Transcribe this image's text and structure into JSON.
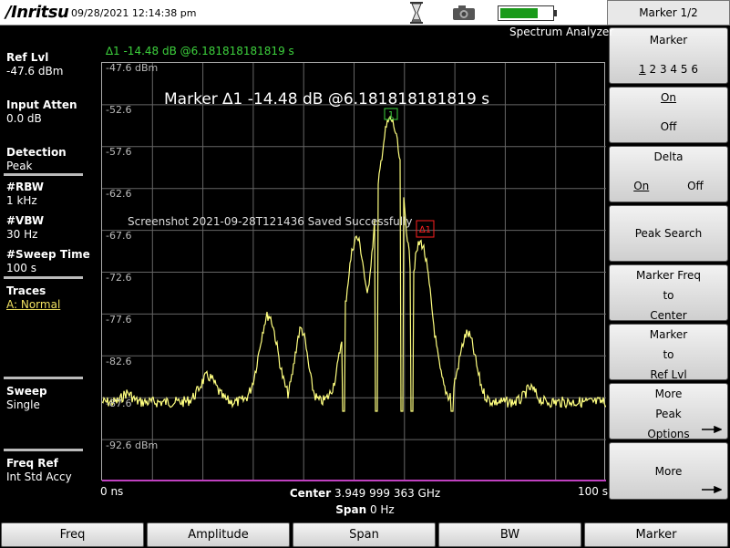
{
  "header": {
    "brand": "/Inritsu",
    "datetime": "09/28/2021 12:14:38 pm",
    "mode": "Spectrum Analyzer"
  },
  "softkeys": {
    "title": "Marker 1/2",
    "marker": {
      "label": "Marker",
      "numbers": [
        "1",
        "2",
        "3",
        "4",
        "5",
        "6"
      ],
      "selected": "1"
    },
    "on_off": {
      "on": "On",
      "off": "Off"
    },
    "delta": {
      "label": "Delta",
      "on": "On",
      "off": "Off"
    },
    "peak_search": "Peak Search",
    "marker_freq_to_center": [
      "Marker Freq",
      "to",
      "Center"
    ],
    "marker_to_ref_lvl": [
      "Marker",
      "to",
      "Ref Lvl"
    ],
    "more_peak_options": [
      "More",
      "Peak",
      "Options"
    ],
    "more": "More"
  },
  "left": {
    "ref_lvl_label": "Ref Lvl",
    "ref_lvl_value": "-47.6 dBm",
    "input_atten_label": "Input Atten",
    "input_atten_value": "0.0 dB",
    "detection_label": "Detection",
    "detection_value": "Peak",
    "rbw_label": "#RBW",
    "rbw_value": "1 kHz",
    "vbw_label": "#VBW",
    "vbw_value": "30 Hz",
    "sweep_time_label": "#Sweep Time",
    "sweep_time_value": "100 s",
    "traces_label": "Traces",
    "traces_value": "A: Normal",
    "sweep_label": "Sweep",
    "sweep_value": "Single",
    "freq_ref_label": "Freq Ref",
    "freq_ref_value": "Int Std Accy"
  },
  "plot": {
    "marker_readout": "∆1 -14.48 dB @6.181818181819 s",
    "big_marker": "Marker ∆1 -14.48 dB @6.181818181819 s",
    "save_message": "Screenshot 2021-09-28T121436 Saved Successfully",
    "marker1_tag": "1",
    "delta_tag": "∆1",
    "y_labels": [
      "-47.6 dBm",
      "-52.6",
      "-57.6",
      "-62.6",
      "-67.6",
      "-72.6",
      "-77.6",
      "-82.6",
      "-87.6",
      "-92.6 dBm"
    ],
    "x_start": "0 ns",
    "x_end": "100 s",
    "center_label": "Center",
    "center_value": "3.949 999 363 GHz",
    "span_label": "Span",
    "span_value": "0 Hz",
    "trace_color": "#ffff80"
  },
  "tabs": [
    "Freq",
    "Amplitude",
    "Span",
    "BW",
    "Marker"
  ]
}
